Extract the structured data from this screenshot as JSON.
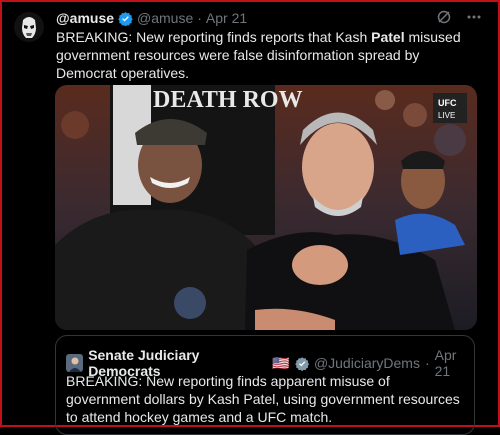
{
  "tweet": {
    "display_name": "@amuse",
    "handle": "@amuse",
    "separator": "·",
    "date": "Apr 21",
    "text_part1": "BREAKING: New reporting finds reports that Kash ",
    "text_bold": "Patel",
    "text_part2": " misused government resources were false disinformation spread by Democrat operatives."
  },
  "photo": {
    "shirt_text": "DEATH ROW",
    "broadcast_badge_1": "UFC",
    "broadcast_badge_2": "LIVE"
  },
  "quote": {
    "display_name": "Senate Judiciary Democrats",
    "flag": "🇺🇸",
    "handle": "@JudiciaryDems",
    "separator": "·",
    "date": "Apr 21",
    "text": "BREAKING: New reporting finds apparent misuse of government dollars by Kash Patel, using government resources to attend hockey games and a UFC match."
  },
  "colors": {
    "background": "#000000",
    "frame": "#c0111b",
    "verified_blue": "#1d9bf0",
    "verified_gray": "#829aab",
    "text_primary": "#e7e9ea",
    "text_secondary": "#71767b"
  },
  "icons": [
    "grok-icon",
    "more-icon",
    "verified-badge-icon"
  ]
}
